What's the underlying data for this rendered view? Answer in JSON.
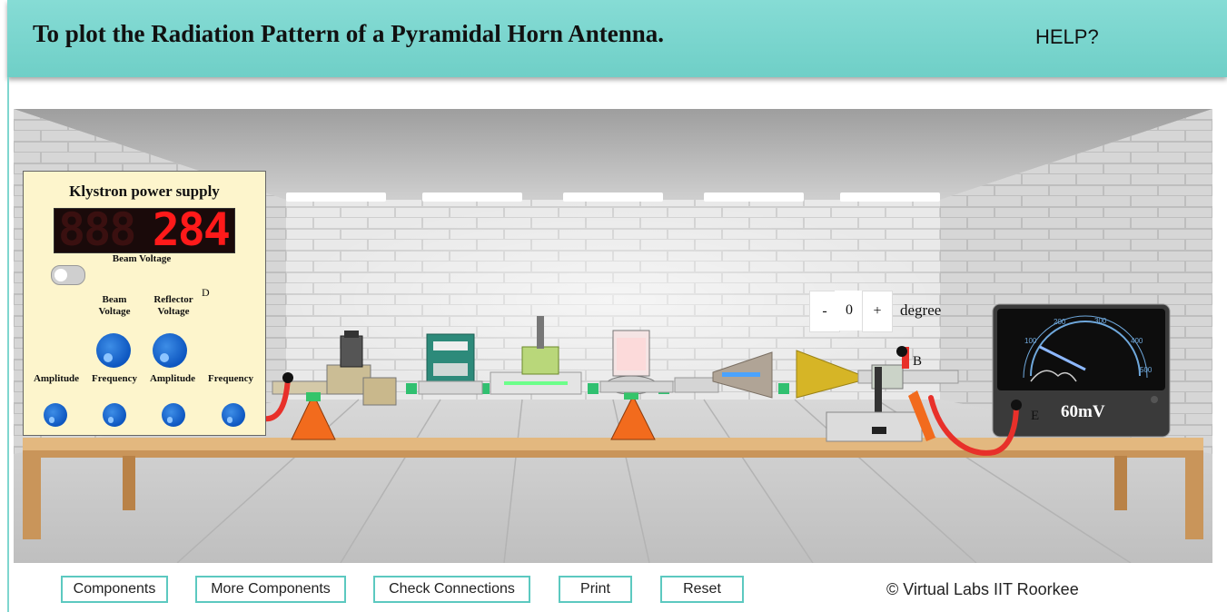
{
  "header": {
    "title": "To plot the Radiation Pattern of a Pyramidal Horn Antenna.",
    "help": "HELP?"
  },
  "power_supply": {
    "title": "Klystron power supply",
    "display_value": "284",
    "display_ghost": "888",
    "display_label": "Beam Voltage",
    "knob_labels": [
      "Beam\nVoltage",
      "Reflector\nVoltage"
    ],
    "bottom_labels": [
      "Amplitude",
      "Frequency",
      "Amplitude",
      "Frequency"
    ],
    "terminal_label": "D"
  },
  "rotation": {
    "minus": "-",
    "value": "0",
    "plus": "+",
    "unit": "degree"
  },
  "meter": {
    "reading": "60mV",
    "scale": [
      "100",
      "200",
      "300",
      "400",
      "500"
    ],
    "terminal_label": "E"
  },
  "receiver": {
    "terminal_label": "B"
  },
  "toolbar": {
    "components": "Components",
    "more_components": "More Components",
    "check_connections": "Check Connections",
    "print": "Print",
    "reset": "Reset"
  },
  "footer": {
    "copyright": "© Virtual Labs IIT Roorkee"
  },
  "colors": {
    "header": "#7fd6cf",
    "button_border": "#5cc9c0",
    "cable": "#e8302a",
    "display_digits": "#ff1a1a",
    "knob": "#1565c0"
  }
}
